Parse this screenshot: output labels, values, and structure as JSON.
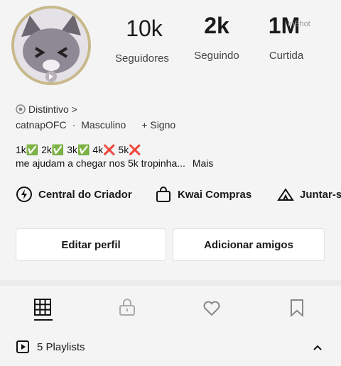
{
  "stats": [
    {
      "value": "10k",
      "label": "Seguidores"
    },
    {
      "value": "2k",
      "label": "Seguindo"
    },
    {
      "value": "1M",
      "label": "Curtida"
    }
  ],
  "watermark": "InShot",
  "badge_label": "Distintivo >",
  "profile": {
    "username": "catnapOFC",
    "separator": "·",
    "gender": "Masculino",
    "sign": "+ Signo"
  },
  "bio": {
    "goals": "1k✅ 2k✅ 3k✅ 4k❌ 5k❌",
    "text": "me ajudam a chegar nos 5k tropinha...",
    "more": "Mais"
  },
  "quick_links": [
    {
      "label": "Central do Criador",
      "icon": "bolt-icon"
    },
    {
      "label": "Kwai Compras",
      "icon": "shopping-bag-icon"
    },
    {
      "label": "Juntar-s",
      "icon": "tent-icon"
    }
  ],
  "buttons": {
    "edit": "Editar perfil",
    "add_friends": "Adicionar amigos"
  },
  "tabs": [
    "grid-icon",
    "lock-icon",
    "heart-icon",
    "bookmark-icon"
  ],
  "playlists": {
    "label": "5 Playlists"
  }
}
